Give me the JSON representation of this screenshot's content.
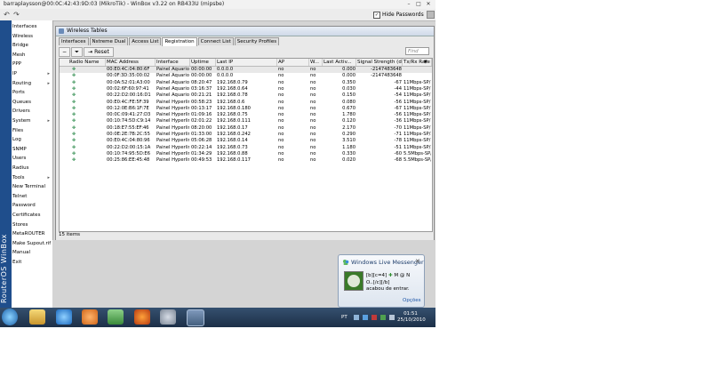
{
  "window": {
    "title": "barraplaysson@00:0C:42:43:9D:03 (MikroTik) - WinBox v3.22 on RB433U (mipsbe)",
    "hide_passwords_label": "Hide Passwords",
    "hide_passwords_checked": true
  },
  "sidebar": {
    "brand": "RouterOS WinBox",
    "items": [
      {
        "label": "Interfaces",
        "arrow": false
      },
      {
        "label": "Wireless",
        "arrow": false
      },
      {
        "label": "Bridge",
        "arrow": false
      },
      {
        "label": "Mesh",
        "arrow": false
      },
      {
        "label": "PPP",
        "arrow": false
      },
      {
        "label": "IP",
        "arrow": true
      },
      {
        "label": "Routing",
        "arrow": true
      },
      {
        "label": "Ports",
        "arrow": false
      },
      {
        "label": "Queues",
        "arrow": false
      },
      {
        "label": "Drivers",
        "arrow": false
      },
      {
        "label": "System",
        "arrow": true
      },
      {
        "label": "Files",
        "arrow": false
      },
      {
        "label": "Log",
        "arrow": false
      },
      {
        "label": "SNMP",
        "arrow": false
      },
      {
        "label": "Users",
        "arrow": false
      },
      {
        "label": "Radius",
        "arrow": false
      },
      {
        "label": "Tools",
        "arrow": true
      },
      {
        "label": "New Terminal",
        "arrow": false
      },
      {
        "label": "Telnet",
        "arrow": false
      },
      {
        "label": "Password",
        "arrow": false
      },
      {
        "label": "Certificates",
        "arrow": false
      },
      {
        "label": "Stores",
        "arrow": false
      },
      {
        "label": "MetaROUTER",
        "arrow": false
      },
      {
        "label": "Make Supout.rif",
        "arrow": false
      },
      {
        "label": "Manual",
        "arrow": false
      },
      {
        "label": "Exit",
        "arrow": false
      }
    ]
  },
  "wireless_tables": {
    "title": "Wireless Tables",
    "tabs": [
      "Interfaces",
      "Nstreme Dual",
      "Access List",
      "Registration",
      "Connect List",
      "Security Profiles"
    ],
    "active_tab": "Registration",
    "reset_label": "Reset",
    "find_placeholder": "Find",
    "columns": [
      "Radio Name",
      "MAC Address",
      "Interface",
      "Uptime",
      "Last IP",
      "AP",
      "W...",
      "Last Activ...",
      "Signal Strength (d...",
      "Tx/Rx Rate"
    ],
    "rows": [
      [
        "",
        "00:E0:4C:04:80:6F",
        "Painel Aquario",
        "00:00:00",
        "0.0.0.0",
        "no",
        "no",
        "0.000",
        "-2147483648",
        ""
      ],
      [
        "",
        "00:0F:3D:35:00:02",
        "Painel Aquario",
        "00:00:00",
        "0.0.0.0",
        "no",
        "no",
        "0.000",
        "-2147483648",
        ""
      ],
      [
        "",
        "00:0A:52:01:A3:00",
        "Painel Aquario",
        "08:20:47",
        "192.168.0.79",
        "no",
        "no",
        "0.350",
        "-67",
        "11Mbps-SP/11Mbps"
      ],
      [
        "",
        "00:02:6F:60:97:41",
        "Painel Aquario",
        "03:16:37",
        "192.168.0.64",
        "no",
        "no",
        "0.030",
        "-44",
        "11Mbps-SP/11Mbps"
      ],
      [
        "",
        "00:22:D2:00:16:D1",
        "Painel Aquario",
        "00:21:21",
        "192.168.0.78",
        "no",
        "no",
        "0.150",
        "-54",
        "11Mbps-SP/11Mbps"
      ],
      [
        "",
        "00:E0:4C:FE:5F:39",
        "Painel Hyperlink",
        "00:58:23",
        "192.168.0.6",
        "no",
        "no",
        "0.080",
        "-56",
        "11Mbps-SP/11Mbps"
      ],
      [
        "",
        "00:12:0E:B6:1F:7E",
        "Painel Hyperlink",
        "00:13:17",
        "192.168.0.180",
        "no",
        "no",
        "0.670",
        "-67",
        "11Mbps-SP/11Mbps"
      ],
      [
        "",
        "00:0C:09:41:27:D3",
        "Painel Hyperlink",
        "01:09:16",
        "192.168.0.75",
        "no",
        "no",
        "1.780",
        "-56",
        "11Mbps-SP/11Mbps"
      ],
      [
        "",
        "00:10:74:5D:C9:14",
        "Painel Hyperlink",
        "02:01:22",
        "192.168.0.111",
        "no",
        "no",
        "0.120",
        "-36",
        "11Mbps-SP/11Mbps"
      ],
      [
        "",
        "00:18:E7:55:EF:46",
        "Painel Hyperlink",
        "08:20:00",
        "192.168.0.17",
        "no",
        "no",
        "2.170",
        "-70",
        "11Mbps-SP/11Mbps"
      ],
      [
        "",
        "00:0E:2E:7B:2C:55",
        "Painel Hyperlink",
        "01:33:00",
        "192.168.0.242",
        "no",
        "no",
        "0.290",
        "-71",
        "11Mbps-SP/2Mbps"
      ],
      [
        "",
        "00:E0:4C:04:80:96",
        "Painel Hyperlink",
        "05:06:28",
        "192.168.0.14",
        "no",
        "no",
        "3.510",
        "-78",
        "11Mbps-SP/1Mbps"
      ],
      [
        "",
        "00:22:D2:00:15:1A",
        "Painel Hyperlink",
        "00:22:14",
        "192.168.0.73",
        "no",
        "no",
        "1.180",
        "-51",
        "11Mbps-SP/5.5Mbps"
      ],
      [
        "",
        "00:10:74:95:5D:E6",
        "Painel Hyperlink",
        "01:34:29",
        "192.168.0.88",
        "no",
        "no",
        "0.330",
        "-60",
        "5.5Mbps-SP/11Mbps"
      ],
      [
        "",
        "00:25:86:EE:45:48",
        "Painel Hyperlink",
        "00:49:53",
        "192.168.0.117",
        "no",
        "no",
        "0.020",
        "-68",
        "5.5Mbps-SP/11Mbps"
      ]
    ],
    "item_count": "15 items"
  },
  "messenger": {
    "title": "Windows Live Messenger",
    "line1": "[b][c=4]",
    "line1b": "M @ N",
    "line2": "O..[/c][/b]",
    "line3": "acabou de entrar.",
    "options": "Opções"
  },
  "taskbar": {
    "language": "PT",
    "time": "01:51",
    "date": "25/10/2010"
  },
  "colors": {
    "sidebar_brand_bg": "#1f4e8c",
    "taskbar_bg": "#1c2f47",
    "messenger_link": "#1d56a8"
  }
}
